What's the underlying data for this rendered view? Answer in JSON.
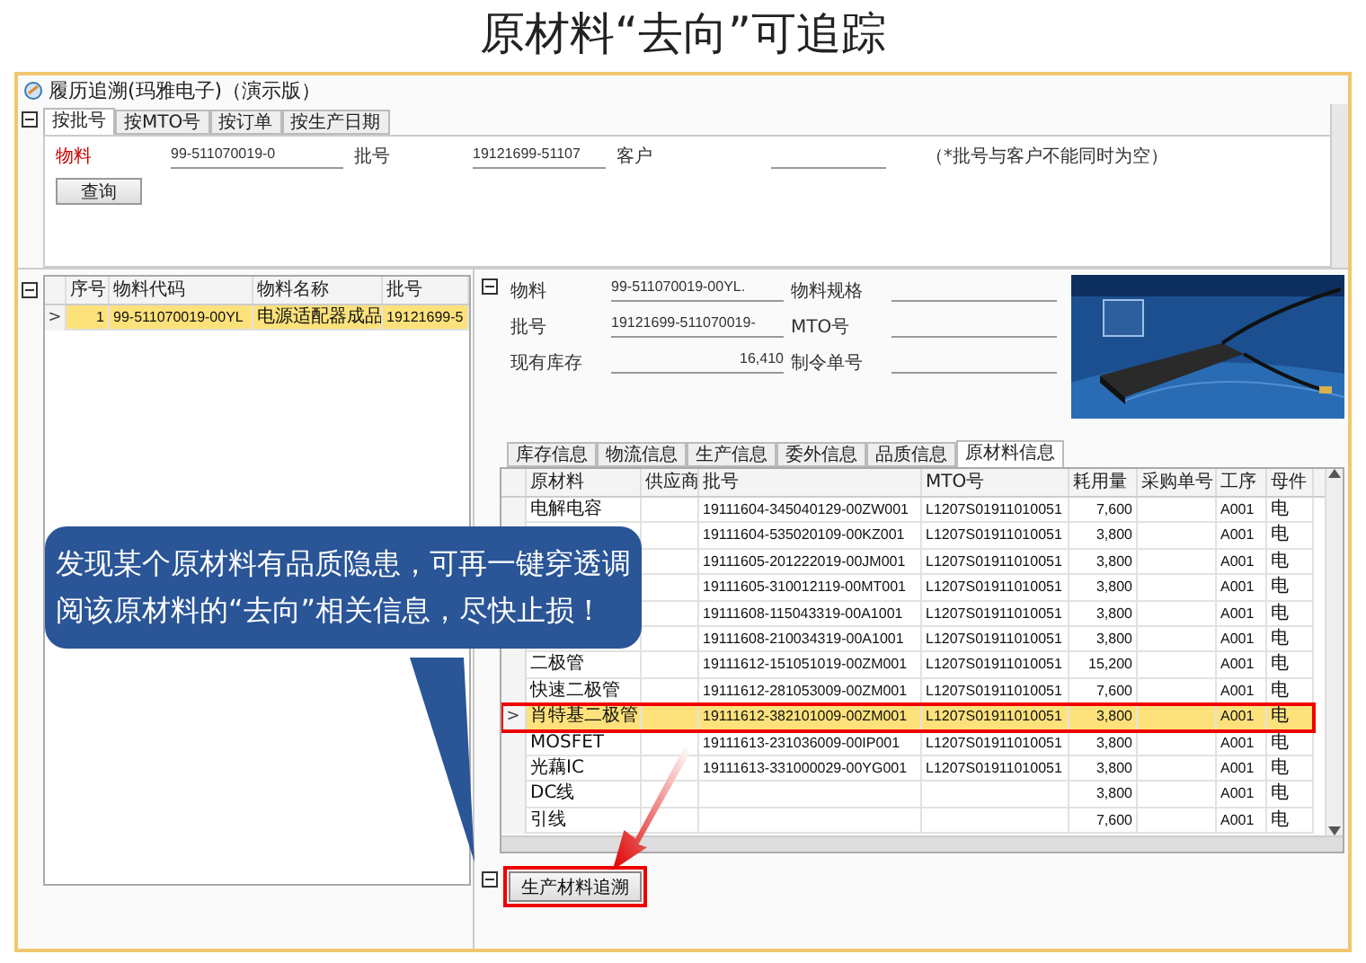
{
  "heading": "原材料“去向”可追踪",
  "window": {
    "title": "履历追溯(玛雅电子)（演示版）"
  },
  "search_tabs": [
    {
      "label": "按批号",
      "selected": true
    },
    {
      "label": "按MTO号",
      "selected": false
    },
    {
      "label": "按订单",
      "selected": false
    },
    {
      "label": "按生产日期",
      "selected": false
    }
  ],
  "search_form": {
    "material_label": "物料",
    "material_value": "99-511070019-0",
    "batch_label": "批号",
    "batch_value": "19121699-51107",
    "customer_label": "客户",
    "note": "（*批号与客户不能同时为空）",
    "query_button": "查询"
  },
  "result_table": {
    "columns": [
      "序号",
      "物料代码",
      "物料名称",
      "批号"
    ],
    "current_row_marker": ">",
    "rows": [
      {
        "cells": [
          "1",
          "99-511070019-00YL",
          "电源适配器成品",
          "19121699-5"
        ],
        "selected": true
      }
    ]
  },
  "detail": {
    "fields": [
      {
        "label": "物料",
        "value": "99-511070019-00YL."
      },
      {
        "label": "物料规格"
      },
      {
        "label": "批号",
        "value": "19121699-511070019-"
      },
      {
        "label": "MTO号"
      },
      {
        "label": "现有库存",
        "value": "16,410"
      },
      {
        "label": "制令单号"
      }
    ]
  },
  "info_tabs": [
    {
      "label": "库存信息",
      "selected": false
    },
    {
      "label": "物流信息",
      "selected": false
    },
    {
      "label": "生产信息",
      "selected": false
    },
    {
      "label": "委外信息",
      "selected": false
    },
    {
      "label": "品质信息",
      "selected": false
    },
    {
      "label": "原材料信息",
      "selected": true
    }
  ],
  "material_table": {
    "columns": [
      "原材料",
      "供应商",
      "批号",
      "MTO号",
      "耗用量",
      "采购单号",
      "工序",
      "母件"
    ],
    "current_row_marker": ">",
    "rows": [
      {
        "material": "电解电容",
        "batch": "19111604-345040129-00ZW001",
        "mto": "L1207S01911010051",
        "qty": "7,600",
        "process": "A001",
        "parent": "电",
        "selected": false
      },
      {
        "batch": "19111604-535020109-00KZ001",
        "mto": "L1207S01911010051",
        "qty": "3,800",
        "process": "A001",
        "parent": "电",
        "selected": false
      },
      {
        "batch": "19111605-201222019-00JM001",
        "mto": "L1207S01911010051",
        "qty": "3,800",
        "process": "A001",
        "parent": "电",
        "selected": false
      },
      {
        "batch": "19111605-310012119-00MT001",
        "mto": "L1207S01911010051",
        "qty": "3,800",
        "process": "A001",
        "parent": "电",
        "selected": false
      },
      {
        "batch": "19111608-115043319-00A1001",
        "mto": "L1207S01911010051",
        "qty": "3,800",
        "process": "A001",
        "parent": "电",
        "selected": false
      },
      {
        "batch": "19111608-210034319-00A1001",
        "mto": "L1207S01911010051",
        "qty": "3,800",
        "process": "A001",
        "parent": "电",
        "selected": false
      },
      {
        "material": "二极管",
        "batch": "19111612-151051019-00ZM001",
        "mto": "L1207S01911010051",
        "qty": "15,200",
        "process": "A001",
        "parent": "电",
        "selected": false
      },
      {
        "material": "快速二极管",
        "batch": "19111612-281053009-00ZM001",
        "mto": "L1207S01911010051",
        "qty": "7,600",
        "process": "A001",
        "parent": "电",
        "selected": false
      },
      {
        "material": "肖特基二极管",
        "batch": "19111612-382101009-00ZM001",
        "mto": "L1207S01911010051",
        "qty": "3,800",
        "process": "A001",
        "parent": "电",
        "selected": true
      },
      {
        "material": "MOSFET",
        "batch": "19111613-231036009-00IP001",
        "mto": "L1207S01911010051",
        "qty": "3,800",
        "process": "A001",
        "parent": "电",
        "selected": false
      },
      {
        "material": "光藕IC",
        "batch": "19111613-331000029-00YG001",
        "mto": "L1207S01911010051",
        "qty": "3,800",
        "process": "A001",
        "parent": "电",
        "selected": false
      },
      {
        "material": "DC线",
        "qty": "3,800",
        "process": "A001",
        "parent": "电",
        "selected": false
      },
      {
        "material": "引线",
        "qty": "7,600",
        "process": "A001",
        "parent": "电",
        "selected": false
      }
    ]
  },
  "trace_button": "生产材料追溯",
  "callout": "发现某个原材料有品质隐患，可再一键穿透调阅该原材料的“去向”相关信息，尽快止损！"
}
